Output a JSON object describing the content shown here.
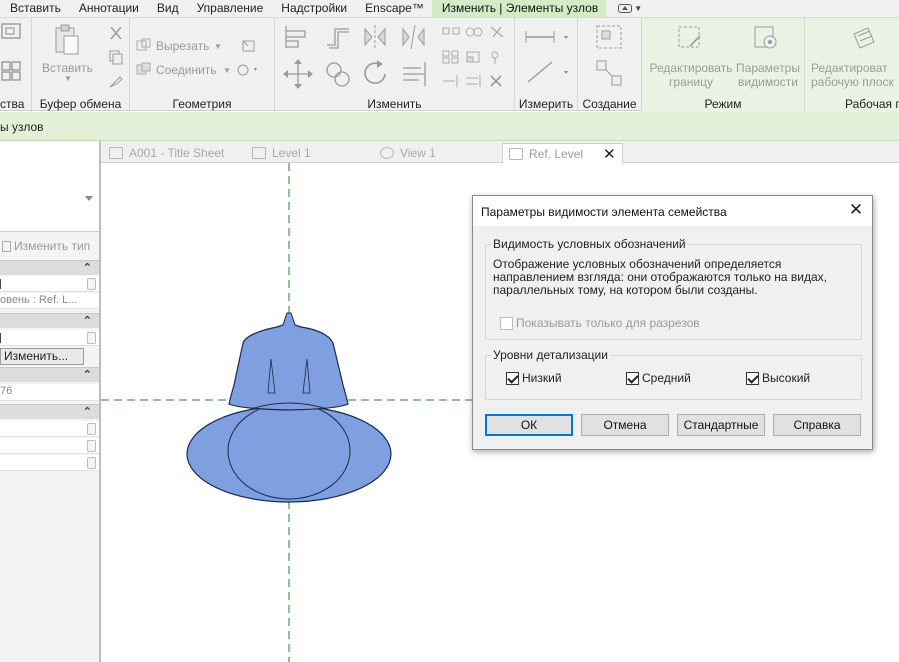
{
  "ribbon_tabs": [
    {
      "label": "Вставить",
      "active": false
    },
    {
      "label": "Аннотации",
      "active": false
    },
    {
      "label": "Вид",
      "active": false
    },
    {
      "label": "Управление",
      "active": false
    },
    {
      "label": "Надстройки",
      "active": false
    },
    {
      "label": "Enscape™",
      "active": false
    },
    {
      "label": "Изменить | Элементы узлов",
      "active": true
    }
  ],
  "ribbon": {
    "panels": {
      "props_partial": "ства",
      "clipboard": "Буфер обмена",
      "geometry": "Геометрия",
      "modify": "Изменить",
      "measure": "Измерить",
      "create": "Создание",
      "mode": "Режим",
      "workplane": "Рабочая пл"
    },
    "clipboard_paste": "Вставить",
    "geometry_cut": "Вырезать",
    "geometry_join": "Соединить",
    "edit_boundary": [
      "Редактировать",
      "границу"
    ],
    "visibility_params": [
      "Параметры",
      "видимости"
    ],
    "edit_workplane": [
      "Редактироват",
      "рабочую плоск"
    ]
  },
  "options_bar": {
    "label": "ы узлов"
  },
  "properties": {
    "edit_type": "Изменить тип",
    "level_value": "овень : Ref. L...",
    "edit_button": "Изменить...",
    "number_value": "76"
  },
  "view_tabs": [
    {
      "label": "A001 - Title Sheet",
      "icon": "sheet-icon"
    },
    {
      "label": "Level 1",
      "icon": "floor-plan-icon"
    },
    {
      "label": "View 1",
      "icon": "3d-view-icon"
    },
    {
      "label": "Ref. Level",
      "icon": "floor-plan-icon",
      "active": true
    }
  ],
  "dialog": {
    "title": "Параметры видимости элемента семейства",
    "group1_label": "Видимость условных обозначений",
    "description": "Отображение условных обозначений определяется направлением взгляда: они отображаются только на видах, параллельных тому, на котором были созданы.",
    "sections_only": {
      "label": "Показывать только для разрезов",
      "checked": false,
      "disabled": true
    },
    "group2_label": "Уровни детализации",
    "levels": [
      {
        "label": "Низкий",
        "checked": true
      },
      {
        "label": "Средний",
        "checked": true
      },
      {
        "label": "Высокий",
        "checked": true
      }
    ],
    "buttons": {
      "ok": "ОК",
      "cancel": "Отмена",
      "defaults": "Стандартные",
      "help": "Справка"
    }
  },
  "colors": {
    "accent_green": "#d4ecc5",
    "fixture_fill": "#7f9fe0",
    "ref_line": "#2e7d32",
    "dialog_default": "#0078d7"
  }
}
